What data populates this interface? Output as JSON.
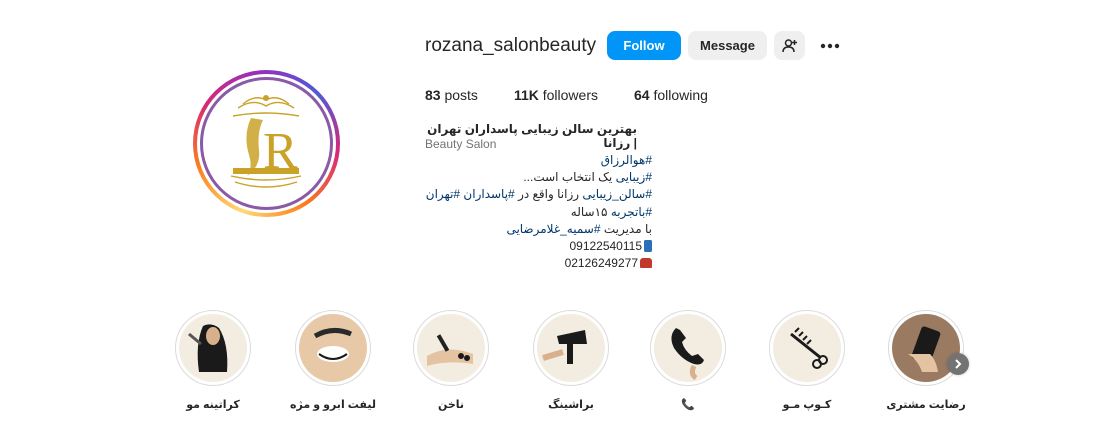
{
  "profile": {
    "username": "rozana_salonbeauty",
    "follow_label": "Follow",
    "message_label": "Message",
    "add_user_icon": "add-user-icon",
    "more_icon": "more-options-icon"
  },
  "stats": {
    "posts_count": "83",
    "posts_label": "posts",
    "followers_count": "11K",
    "followers_label": "followers",
    "following_count": "64",
    "following_label": "following"
  },
  "bio": {
    "name": "بهترین سالن زیبایی پاسداران تهران | رزانا",
    "category": "Beauty Salon",
    "line1_tag": "#هوالرزاق",
    "line2_tag": "#زیبایی",
    "line2_text": " یک انتخاب است...",
    "line3_tag1": "#سالن_زیبایی",
    "line3_text": " رزانا واقع در ",
    "line3_tag2": "#پاسداران",
    "line3_tag3": " #تهران",
    "line4_tag": "#باتجربه",
    "line4_text": " ۱۵ساله",
    "line5_text": "با مدیریت ",
    "line5_tag": "#سمیه_غلامرضایی",
    "phone_mobile": "09122540115",
    "phone_mobile_icon": "mobile-phone-icon",
    "phone_landline": "02126249277",
    "phone_landline_icon": "telephone-icon"
  },
  "highlights": [
    {
      "label": "کراتینه مو",
      "icon": "keratin-hair-icon"
    },
    {
      "label": "لیفت ابرو و مژه",
      "icon": "brow-lash-lift-icon"
    },
    {
      "label": "ناخن",
      "icon": "nail-icon"
    },
    {
      "label": "براشینگ",
      "icon": "hair-dryer-icon"
    },
    {
      "label": "📞",
      "icon": "phone-icon"
    },
    {
      "label": "کـوپ مـو",
      "icon": "comb-scissors-icon"
    },
    {
      "label": "رضایت مشتری",
      "icon": "customer-satisfaction-icon"
    }
  ],
  "colors": {
    "follow_button": "#0095f6",
    "secondary_button": "#efefef",
    "hashtag": "#00376b",
    "muted_text": "#737373",
    "logo_gold": "#c9a227",
    "logo_purple": "#8a5aa8"
  }
}
